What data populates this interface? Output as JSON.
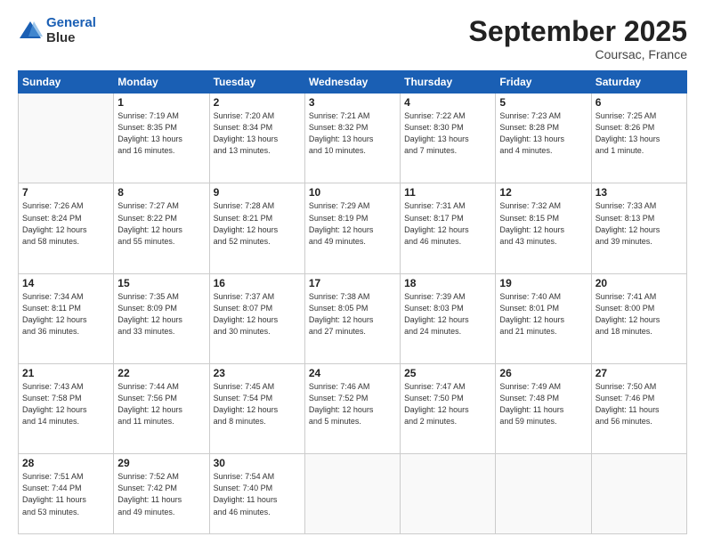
{
  "header": {
    "logo_line1": "General",
    "logo_line2": "Blue",
    "month": "September 2025",
    "location": "Coursac, France"
  },
  "days_of_week": [
    "Sunday",
    "Monday",
    "Tuesday",
    "Wednesday",
    "Thursday",
    "Friday",
    "Saturday"
  ],
  "weeks": [
    [
      {
        "day": "",
        "info": ""
      },
      {
        "day": "1",
        "info": "Sunrise: 7:19 AM\nSunset: 8:35 PM\nDaylight: 13 hours\nand 16 minutes."
      },
      {
        "day": "2",
        "info": "Sunrise: 7:20 AM\nSunset: 8:34 PM\nDaylight: 13 hours\nand 13 minutes."
      },
      {
        "day": "3",
        "info": "Sunrise: 7:21 AM\nSunset: 8:32 PM\nDaylight: 13 hours\nand 10 minutes."
      },
      {
        "day": "4",
        "info": "Sunrise: 7:22 AM\nSunset: 8:30 PM\nDaylight: 13 hours\nand 7 minutes."
      },
      {
        "day": "5",
        "info": "Sunrise: 7:23 AM\nSunset: 8:28 PM\nDaylight: 13 hours\nand 4 minutes."
      },
      {
        "day": "6",
        "info": "Sunrise: 7:25 AM\nSunset: 8:26 PM\nDaylight: 13 hours\nand 1 minute."
      }
    ],
    [
      {
        "day": "7",
        "info": "Sunrise: 7:26 AM\nSunset: 8:24 PM\nDaylight: 12 hours\nand 58 minutes."
      },
      {
        "day": "8",
        "info": "Sunrise: 7:27 AM\nSunset: 8:22 PM\nDaylight: 12 hours\nand 55 minutes."
      },
      {
        "day": "9",
        "info": "Sunrise: 7:28 AM\nSunset: 8:21 PM\nDaylight: 12 hours\nand 52 minutes."
      },
      {
        "day": "10",
        "info": "Sunrise: 7:29 AM\nSunset: 8:19 PM\nDaylight: 12 hours\nand 49 minutes."
      },
      {
        "day": "11",
        "info": "Sunrise: 7:31 AM\nSunset: 8:17 PM\nDaylight: 12 hours\nand 46 minutes."
      },
      {
        "day": "12",
        "info": "Sunrise: 7:32 AM\nSunset: 8:15 PM\nDaylight: 12 hours\nand 43 minutes."
      },
      {
        "day": "13",
        "info": "Sunrise: 7:33 AM\nSunset: 8:13 PM\nDaylight: 12 hours\nand 39 minutes."
      }
    ],
    [
      {
        "day": "14",
        "info": "Sunrise: 7:34 AM\nSunset: 8:11 PM\nDaylight: 12 hours\nand 36 minutes."
      },
      {
        "day": "15",
        "info": "Sunrise: 7:35 AM\nSunset: 8:09 PM\nDaylight: 12 hours\nand 33 minutes."
      },
      {
        "day": "16",
        "info": "Sunrise: 7:37 AM\nSunset: 8:07 PM\nDaylight: 12 hours\nand 30 minutes."
      },
      {
        "day": "17",
        "info": "Sunrise: 7:38 AM\nSunset: 8:05 PM\nDaylight: 12 hours\nand 27 minutes."
      },
      {
        "day": "18",
        "info": "Sunrise: 7:39 AM\nSunset: 8:03 PM\nDaylight: 12 hours\nand 24 minutes."
      },
      {
        "day": "19",
        "info": "Sunrise: 7:40 AM\nSunset: 8:01 PM\nDaylight: 12 hours\nand 21 minutes."
      },
      {
        "day": "20",
        "info": "Sunrise: 7:41 AM\nSunset: 8:00 PM\nDaylight: 12 hours\nand 18 minutes."
      }
    ],
    [
      {
        "day": "21",
        "info": "Sunrise: 7:43 AM\nSunset: 7:58 PM\nDaylight: 12 hours\nand 14 minutes."
      },
      {
        "day": "22",
        "info": "Sunrise: 7:44 AM\nSunset: 7:56 PM\nDaylight: 12 hours\nand 11 minutes."
      },
      {
        "day": "23",
        "info": "Sunrise: 7:45 AM\nSunset: 7:54 PM\nDaylight: 12 hours\nand 8 minutes."
      },
      {
        "day": "24",
        "info": "Sunrise: 7:46 AM\nSunset: 7:52 PM\nDaylight: 12 hours\nand 5 minutes."
      },
      {
        "day": "25",
        "info": "Sunrise: 7:47 AM\nSunset: 7:50 PM\nDaylight: 12 hours\nand 2 minutes."
      },
      {
        "day": "26",
        "info": "Sunrise: 7:49 AM\nSunset: 7:48 PM\nDaylight: 11 hours\nand 59 minutes."
      },
      {
        "day": "27",
        "info": "Sunrise: 7:50 AM\nSunset: 7:46 PM\nDaylight: 11 hours\nand 56 minutes."
      }
    ],
    [
      {
        "day": "28",
        "info": "Sunrise: 7:51 AM\nSunset: 7:44 PM\nDaylight: 11 hours\nand 53 minutes."
      },
      {
        "day": "29",
        "info": "Sunrise: 7:52 AM\nSunset: 7:42 PM\nDaylight: 11 hours\nand 49 minutes."
      },
      {
        "day": "30",
        "info": "Sunrise: 7:54 AM\nSunset: 7:40 PM\nDaylight: 11 hours\nand 46 minutes."
      },
      {
        "day": "",
        "info": ""
      },
      {
        "day": "",
        "info": ""
      },
      {
        "day": "",
        "info": ""
      },
      {
        "day": "",
        "info": ""
      }
    ]
  ]
}
